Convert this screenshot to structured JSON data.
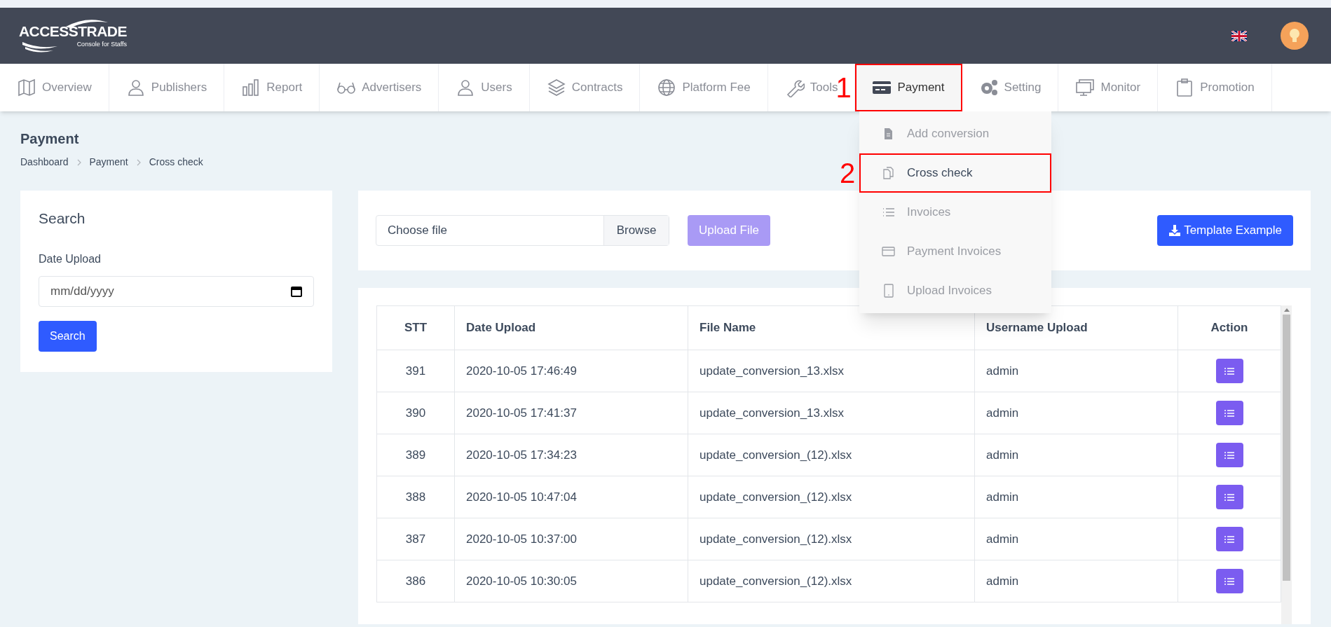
{
  "header": {
    "logo": {
      "name": "ACCESSTRADE",
      "tagline": "Console for Staffs"
    }
  },
  "nav": [
    {
      "label": "Overview",
      "selected": false
    },
    {
      "label": "Publishers",
      "selected": false
    },
    {
      "label": "Report",
      "selected": false
    },
    {
      "label": "Advertisers",
      "selected": false
    },
    {
      "label": "Users",
      "selected": false
    },
    {
      "label": "Contracts",
      "selected": false
    },
    {
      "label": "Platform Fee",
      "selected": false
    },
    {
      "label": "Tools",
      "selected": false
    },
    {
      "label": "Payment",
      "selected": true,
      "annotation": "1"
    },
    {
      "label": "Setting",
      "selected": false
    },
    {
      "label": "Monitor",
      "selected": false
    },
    {
      "label": "Promotion",
      "selected": false
    }
  ],
  "dropdown": [
    {
      "label": "Add conversion",
      "selected": false
    },
    {
      "label": "Cross check",
      "selected": true,
      "annotation": "2"
    },
    {
      "label": "Invoices",
      "selected": false
    },
    {
      "label": "Payment Invoices",
      "selected": false
    },
    {
      "label": "Upload Invoices",
      "selected": false
    }
  ],
  "page": {
    "title": "Payment",
    "breadcrumb": [
      "Dashboard",
      "Payment",
      "Cross check"
    ]
  },
  "search": {
    "title": "Search",
    "label": "Date Upload",
    "placeholder": "mm/dd/yyyy",
    "button": "Search"
  },
  "upload": {
    "placeholder": "Choose file",
    "browse": "Browse",
    "upload_button": {
      "label": "Upload File",
      "disabled": true
    },
    "template_button": "Template Example"
  },
  "table": {
    "columns": [
      "STT",
      "Date Upload",
      "File Name",
      "Username Upload",
      "Action"
    ],
    "rows": [
      [
        "391",
        "2020-10-05 17:46:49",
        "update_conversion_13.xlsx",
        "admin"
      ],
      [
        "390",
        "2020-10-05 17:41:37",
        "update_conversion_13.xlsx",
        "admin"
      ],
      [
        "389",
        "2020-10-05 17:34:23",
        "update_conversion_(12).xlsx",
        "admin"
      ],
      [
        "388",
        "2020-10-05 10:47:04",
        "update_conversion_(12).xlsx",
        "admin"
      ],
      [
        "387",
        "2020-10-05 10:37:00",
        "update_conversion_(12).xlsx",
        "admin"
      ],
      [
        "386",
        "2020-10-05 10:30:05",
        "update_conversion_(12).xlsx",
        "admin"
      ]
    ]
  }
}
